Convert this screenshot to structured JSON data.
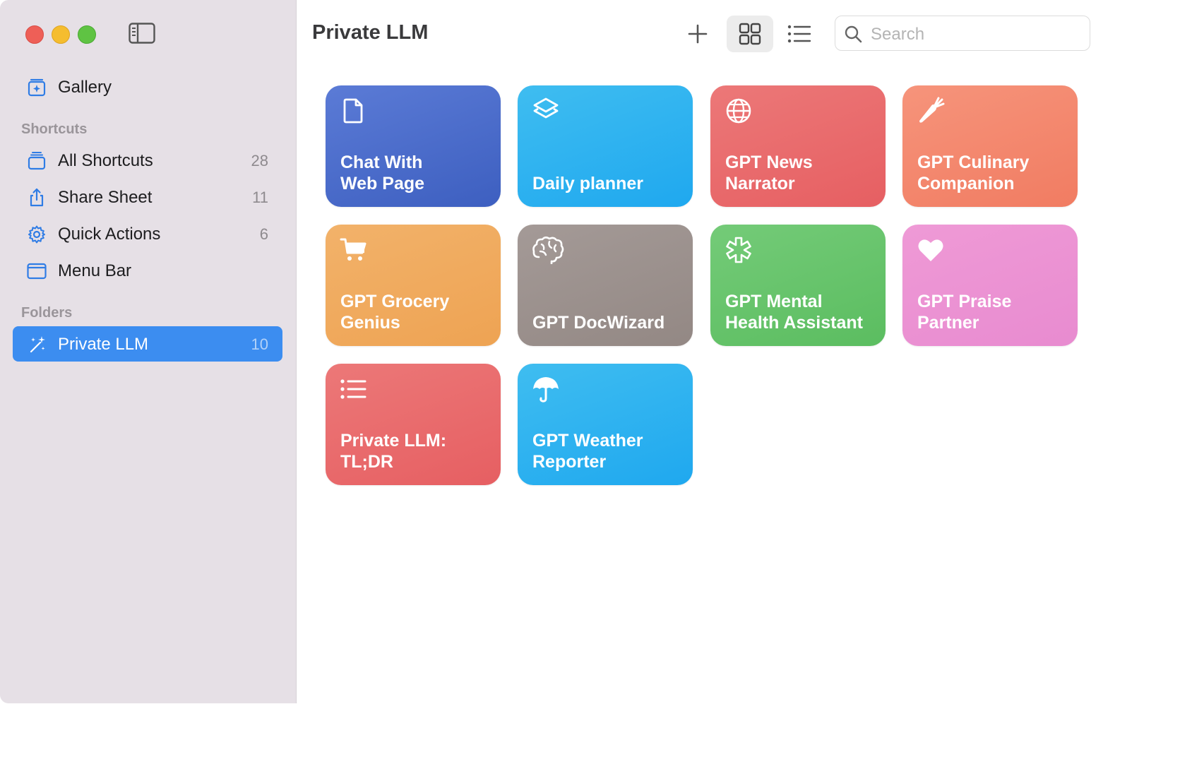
{
  "window": {
    "title": "Private LLM",
    "traffic_lights": [
      "close",
      "minimize",
      "zoom"
    ]
  },
  "sidebar": {
    "gallery": {
      "label": "Gallery",
      "icon": "gallery-icon"
    },
    "shortcuts_section": "Shortcuts",
    "shortcuts": [
      {
        "label": "All Shortcuts",
        "count": "28",
        "icon": "stack-icon"
      },
      {
        "label": "Share Sheet",
        "count": "11",
        "icon": "share-icon"
      },
      {
        "label": "Quick Actions",
        "count": "6",
        "icon": "gear-icon"
      },
      {
        "label": "Menu Bar",
        "count": "",
        "icon": "menubar-icon"
      }
    ],
    "folders_section": "Folders",
    "folders": [
      {
        "label": "Private LLM",
        "count": "10",
        "icon": "sparkles-icon",
        "selected": true
      }
    ]
  },
  "toolbar": {
    "add": "plus-icon",
    "view_grid": "grid-icon",
    "view_list": "list-icon",
    "view_mode": "grid",
    "search_placeholder": "Search",
    "search_value": ""
  },
  "cards": [
    {
      "title": "Chat With\nWeb Page",
      "icon": "document-icon",
      "color_from": "#5b7bd6",
      "color_to": "#3d5fc0"
    },
    {
      "title": "Daily planner",
      "icon": "layers-icon",
      "color_from": "#3fbdf0",
      "color_to": "#1fa8ef"
    },
    {
      "title": "GPT News\nNarrator",
      "icon": "globe-icon",
      "color_from": "#ec7878",
      "color_to": "#e65f62"
    },
    {
      "title": "GPT Culinary\nCompanion",
      "icon": "carrot-icon",
      "color_from": "#f6947b",
      "color_to": "#f17c62"
    },
    {
      "title": "GPT Grocery\nGenius",
      "icon": "cart-icon",
      "color_from": "#f2b26a",
      "color_to": "#eea353"
    },
    {
      "title": "GPT DocWizard",
      "icon": "brain-icon",
      "color_from": "#a49a97",
      "color_to": "#938884"
    },
    {
      "title": "GPT Mental\nHealth Assistant",
      "icon": "medical-icon",
      "color_from": "#74cb78",
      "color_to": "#5bbd60"
    },
    {
      "title": "GPT Praise\nPartner",
      "icon": "heart-icon",
      "color_from": "#ef9ad6",
      "color_to": "#e88bd0"
    },
    {
      "title": "Private LLM:\nTL;DR",
      "icon": "list-icon",
      "color_from": "#ec7878",
      "color_to": "#e65f62"
    },
    {
      "title": "GPT Weather\nReporter",
      "icon": "umbrella-icon",
      "color_from": "#3fbdf0",
      "color_to": "#1fa8ef"
    }
  ]
}
